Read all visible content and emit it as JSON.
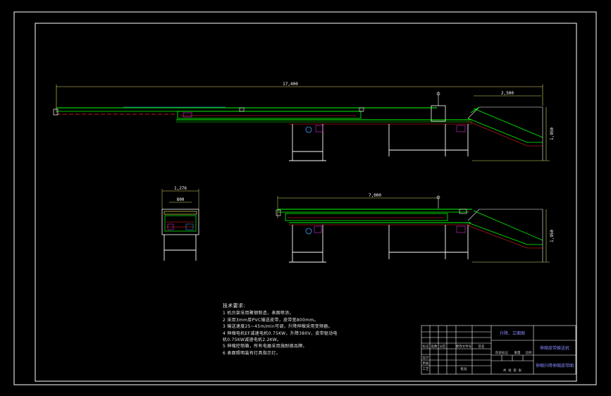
{
  "colors": {
    "background": "#000000",
    "frame": "#ffffff",
    "conveyor": "#00ff00",
    "belt": "#ff0000",
    "frame_legs": "#ffffff",
    "dimension": "#ffff66",
    "accent_blue": "#3aa0ff",
    "accent_magenta": "#ff33ff",
    "title_text": "#8888ff"
  },
  "dimensions": {
    "top_length": "17,400",
    "top_ramp": "2,500",
    "top_height": "1,950",
    "side_outer": "1,276",
    "side_inner": "800",
    "bottom_length": "7,000",
    "bottom_height": "1,950"
  },
  "notes": {
    "title": "技术要求:",
    "lines": [
      "1 机台架采用聚钢制造，表面喷涂。",
      "2 采用3mm厚PVC输送皮带，皮带宽800mm。",
      "3 输送速度25~45m/min可调，升降伸缩采用变频器。",
      "4 伸缩电机EF减速电机0.75KW，升降380V，皮带驱动电",
      "机0.75KW减速电机2.2KW。",
      "5 伸缩控制箱，所有电器采用施耐德品牌。",
      "6 表面照明装有灯具指示灯。"
    ]
  },
  "title_block": {
    "name": "升降、立面图",
    "product": "伸缩皮带输送机",
    "drawing": "伸缩升降伸缩皮带图",
    "row_labels": [
      "标记",
      "处数",
      "分区",
      "更改文件号",
      "签名",
      "年月日"
    ],
    "role_labels": [
      "设计",
      "审核",
      "工艺",
      "批准"
    ],
    "extra_labels": [
      "阶段标记",
      "重量",
      "比例",
      "共 张 第 张"
    ]
  }
}
